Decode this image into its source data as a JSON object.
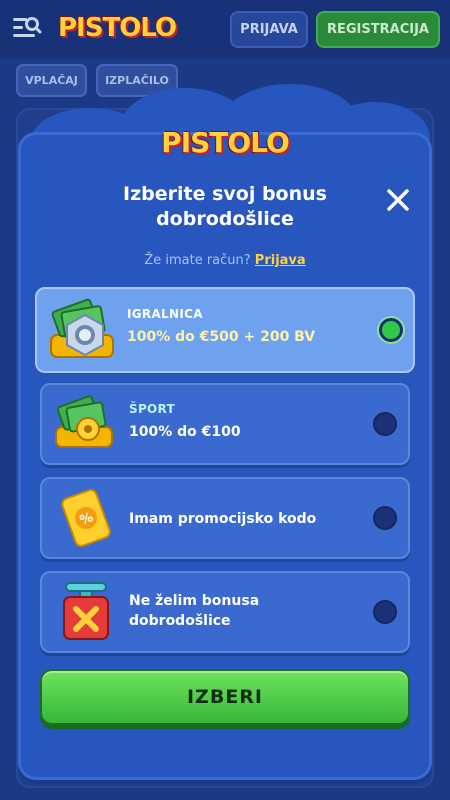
{
  "topbar": {
    "logo_text": "PISTOLO",
    "login_label": "PRIJAVA",
    "register_label": "REGISTRACIJA"
  },
  "subtabs": [
    {
      "label": "VPLAČAJ"
    },
    {
      "label": "IZPLAČILO"
    }
  ],
  "modal": {
    "logo_text": "PISTOLO",
    "title": "Izberite svoj bonus dobrodošlice",
    "login_prompt": "Že imate račun?",
    "login_link": "Prijava",
    "options": [
      {
        "label": "IGRALNICA",
        "value": "100% do €500 + 200 BV",
        "selected": true,
        "icon": "cash-chest-icon"
      },
      {
        "label": "ŠPORT",
        "value": "100% do €100",
        "selected": false,
        "icon": "cash-ball-icon"
      },
      {
        "label": "",
        "value": "Imam promocijsko kodo",
        "selected": false,
        "icon": "promo-ticket-icon"
      },
      {
        "label": "",
        "value": "Ne želim bonusa dobrodošlice",
        "selected": false,
        "icon": "red-box-icon"
      }
    ],
    "choose_label": "IZBERI"
  },
  "colors": {
    "modal_bg": "#2756bf",
    "accent_green": "#38b73a",
    "accent_yellow": "#ffd23a"
  }
}
